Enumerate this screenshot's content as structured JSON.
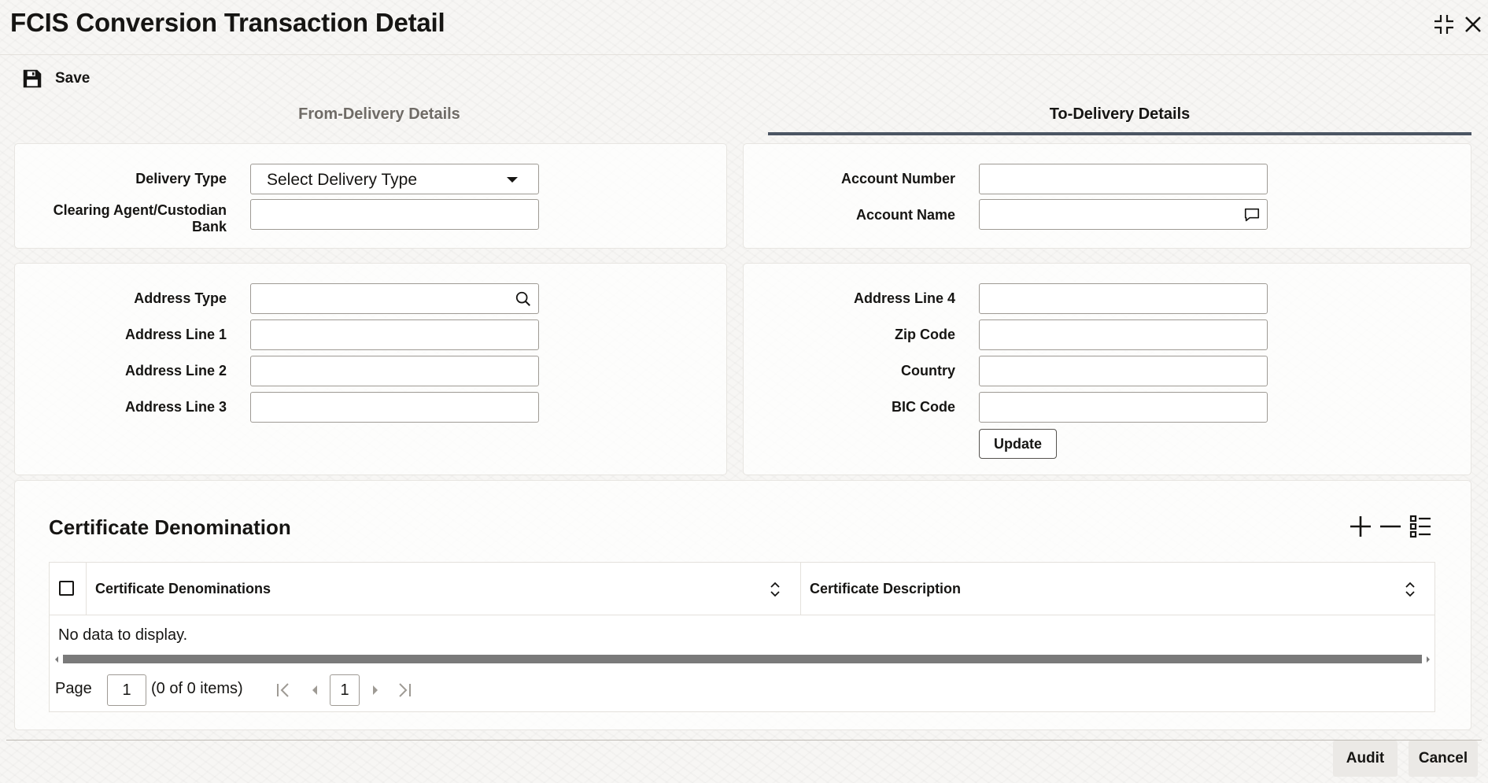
{
  "window": {
    "title": "FCIS Conversion Transaction Detail",
    "minimize_icon": "collapse-icon",
    "close_icon": "close-icon"
  },
  "toolbar": {
    "save_label": "Save",
    "save_icon": "floppy-disk-icon"
  },
  "tabs": [
    {
      "label": "From-Delivery Details",
      "active": false
    },
    {
      "label": "To-Delivery Details",
      "active": true
    }
  ],
  "delivery": {
    "delivery_type_label": "Delivery Type",
    "delivery_type_value": "Select Delivery Type",
    "clearing_agent_label_1": "Clearing Agent/Custodian",
    "clearing_agent_label_2": "Bank",
    "clearing_agent_value": "",
    "account_number_label": "Account Number",
    "account_number_value": "",
    "account_name_label": "Account Name",
    "account_name_value": ""
  },
  "address": {
    "address_type_label": "Address Type",
    "address_line1_label": "Address Line 1",
    "address_line2_label": "Address Line 2",
    "address_line3_label": "Address Line 3",
    "address_line4_label": "Address Line 4",
    "zip_code_label": "Zip Code",
    "country_label": "Country",
    "bic_code_label": "BIC Code",
    "update_label": "Update"
  },
  "certificates": {
    "title": "Certificate Denomination",
    "columns": [
      "Certificate Denominations",
      "Certificate Description"
    ],
    "rows": [],
    "empty_text": "No data to display.",
    "page_label": "Page",
    "page_number": "1",
    "item_count": "(0 of 0 items)",
    "current_page": "1"
  },
  "footer": {
    "audit_label": "Audit",
    "cancel_label": "Cancel"
  },
  "colors": {
    "tab_underline": "#4b5563",
    "scrollbar": "#7a7a7a",
    "footer_button": "#ebe9e6"
  }
}
